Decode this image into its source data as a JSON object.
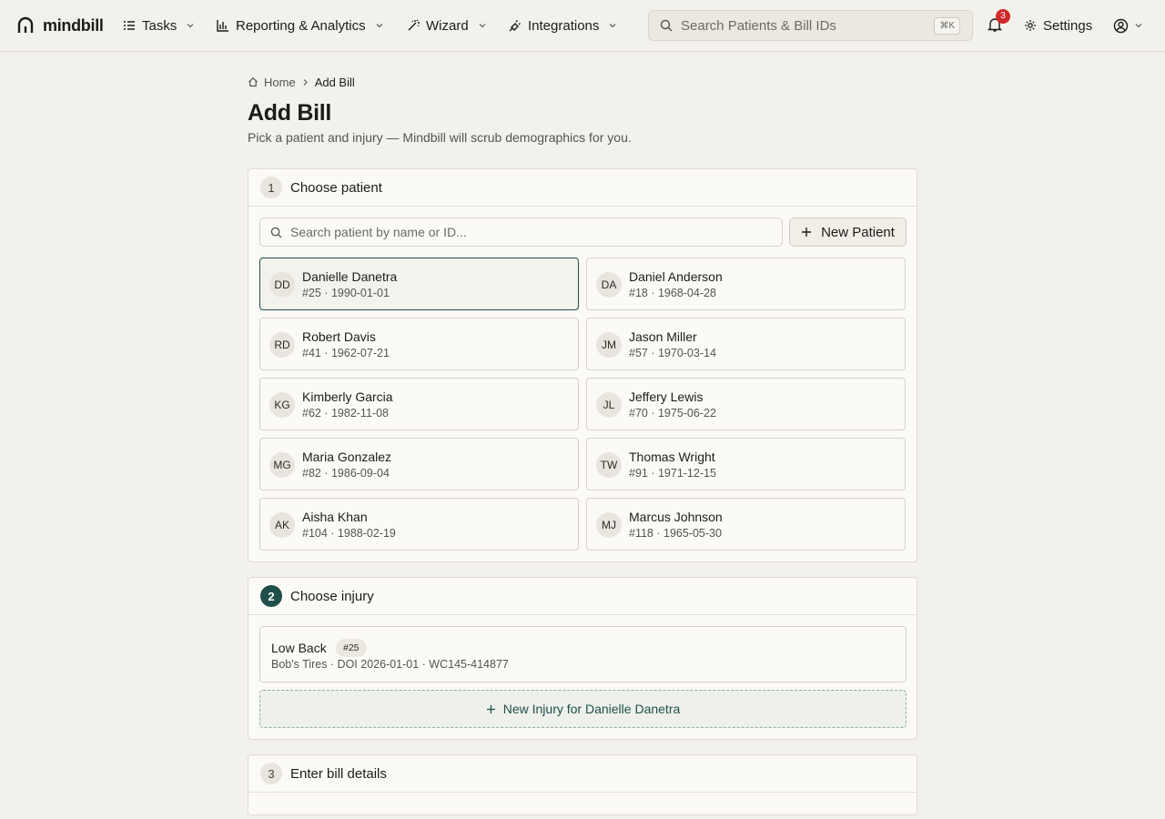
{
  "app": {
    "name": "mindbill"
  },
  "nav": {
    "items": [
      {
        "label": "Tasks",
        "icon": "list-icon"
      },
      {
        "label": "Reporting & Analytics",
        "icon": "bar-chart-icon"
      },
      {
        "label": "Wizard",
        "icon": "magic-wand-icon"
      },
      {
        "label": "Integrations",
        "icon": "plug-icon"
      }
    ],
    "search_placeholder": "Search Patients & Bill IDs",
    "search_shortcut": "⌘K",
    "notification_count": "3",
    "settings_label": "Settings"
  },
  "breadcrumb": {
    "home": "Home",
    "current": "Add Bill"
  },
  "page": {
    "title": "Add Bill",
    "subtitle": "Pick a patient and injury — Mindbill will scrub demographics for you."
  },
  "step1": {
    "number": "1",
    "title": "Choose patient",
    "search_placeholder": "Search patient by name or ID...",
    "new_patient_label": "New Patient",
    "patients": [
      {
        "initials": "DD",
        "name": "Danielle Danetra",
        "meta": "#25 · 1990-01-01",
        "selected": true
      },
      {
        "initials": "DA",
        "name": "Daniel Anderson",
        "meta": "#18 · 1968-04-28"
      },
      {
        "initials": "RD",
        "name": "Robert Davis",
        "meta": "#41 · 1962-07-21"
      },
      {
        "initials": "JM",
        "name": "Jason Miller",
        "meta": "#57 · 1970-03-14"
      },
      {
        "initials": "KG",
        "name": "Kimberly Garcia",
        "meta": "#62 · 1982-11-08"
      },
      {
        "initials": "JL",
        "name": "Jeffery Lewis",
        "meta": "#70 · 1975-06-22"
      },
      {
        "initials": "MG",
        "name": "Maria Gonzalez",
        "meta": "#82 · 1986-09-04"
      },
      {
        "initials": "TW",
        "name": "Thomas Wright",
        "meta": "#91 · 1971-12-15"
      },
      {
        "initials": "AK",
        "name": "Aisha Khan",
        "meta": "#104 · 1988-02-19"
      },
      {
        "initials": "MJ",
        "name": "Marcus Johnson",
        "meta": "#118 · 1965-05-30"
      }
    ]
  },
  "step2": {
    "number": "2",
    "title": "Choose injury",
    "injury": {
      "title": "Low Back",
      "badge": "#25",
      "meta": "Bob's Tires · DOI 2026-01-01 · WC145-414877"
    },
    "new_injury_label": "New Injury for Danielle Danetra"
  },
  "step3": {
    "number": "3",
    "title": "Enter bill details"
  },
  "colors": {
    "accent": "#1f4f4a",
    "badge": "#d02a2a",
    "background": "#f3f1ec"
  }
}
